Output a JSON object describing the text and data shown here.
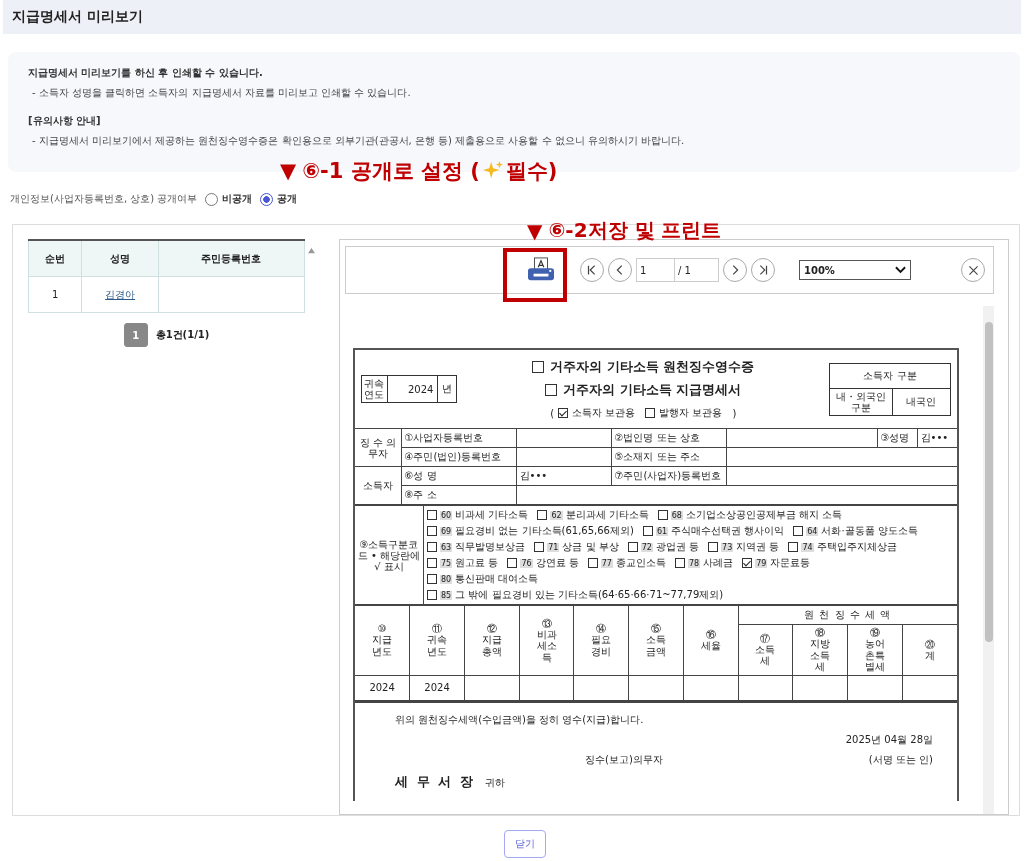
{
  "title": "지급명세서 미리보기",
  "notice": [
    {
      "heading": "지급명세서 미리보기를 하신 후 인쇄할 수 있습니다.",
      "detail": "- 소득자 성명을 클릭하면 소득자의 지급명세서 자료를 미리보고 인쇄할 수 있습니다."
    },
    {
      "heading": "[유의사항 안내]",
      "detail": "- 지급명세서 미리보기에서 제공하는 원천징수영수증은 확인용으로 외부기관(관공서, 은행 등) 제출용으로 사용할 수 없으니 유의하시기 바랍니다."
    }
  ],
  "annotation_1": {
    "arrow": "▼",
    "text": "⑥-1 공개로 설정 (",
    "tail": "필수)"
  },
  "annotation_2": {
    "arrow": "▼",
    "text": "⑥-2저장 및 프린트"
  },
  "disclosure": {
    "label": "개인정보(사업자등록번호, 상호) 공개여부",
    "options": [
      {
        "label": "비공개",
        "selected": false
      },
      {
        "label": "공개",
        "selected": true
      }
    ]
  },
  "earner_table": {
    "columns": [
      "순번",
      "성명",
      "주민등록번호"
    ],
    "rows": [
      {
        "no": "1",
        "name": "김경아"
      }
    ]
  },
  "pagination": {
    "pages": [
      {
        "label": "1",
        "selected": true
      }
    ],
    "total": "총1건(1/1)"
  },
  "viewer": {
    "page": "1",
    "page_total": "/ 1",
    "zoom": "100%"
  },
  "doc": {
    "year_label": "귀속연도",
    "year": "2024",
    "year_unit": "년",
    "titles": [
      {
        "text": "거주자의 기타소득 원천징수영수증",
        "checked": false
      },
      {
        "text": "거주자의 기타소득 지급명세서",
        "checked": false
      }
    ],
    "paren_open": "(",
    "paren_close": ")",
    "copies": [
      {
        "text": "소득자 보관용",
        "checked": true
      },
      {
        "text": "발행자 보관용",
        "checked": false
      }
    ],
    "class_title": "소득자 구분",
    "class_label": "내・외국인 구분",
    "class_value": "내국인",
    "payer": {
      "label": "징 수 의무자",
      "reg_no": "①사업자등록번호",
      "company": "②법인명 또는 상호",
      "name_label": "③성명",
      "name": "김•••",
      "id_no": "④주민(법인)등록번호",
      "address": "⑤소재지 또는 주소"
    },
    "earner": {
      "label": "소득자",
      "name_label": "⑥성 명",
      "name": "김•••",
      "id_no": "⑦주민(사업자)등록번호",
      "address": "⑧주 소"
    },
    "income_label": "⑨소득구분코드 • 해당란에 √ 표시",
    "income_types": [
      {
        "items": [
          {
            "code": "60",
            "text": "비과세 기타소득",
            "checked": false
          },
          {
            "code": "62",
            "text": "분리과세 기타소득",
            "checked": false
          },
          {
            "code": "68",
            "text": "소기업소상공인공제부금 해지 소득",
            "checked": false
          }
        ]
      },
      {
        "items": [
          {
            "code": "69",
            "text": "필요경비 없는 기타소득(61,65,66제외)",
            "checked": false
          },
          {
            "code": "61",
            "text": "주식매수선택권 행사이익",
            "checked": false
          },
          {
            "code": "64",
            "text": "서화·골동품 양도소득",
            "checked": false
          }
        ]
      },
      {
        "items": [
          {
            "code": "63",
            "text": "직무발명보상금",
            "checked": false
          },
          {
            "code": "71",
            "text": "상금 및 부상",
            "checked": false
          },
          {
            "code": "72",
            "text": "광업권 등",
            "checked": false
          },
          {
            "code": "73",
            "text": "지역권 등",
            "checked": false
          },
          {
            "code": "74",
            "text": "주택입주지체상금",
            "checked": false
          }
        ]
      },
      {
        "items": [
          {
            "code": "75",
            "text": "원고료 등",
            "checked": false
          },
          {
            "code": "76",
            "text": "강연료 등",
            "checked": false
          },
          {
            "code": "77",
            "text": "종교인소득",
            "checked": false
          },
          {
            "code": "78",
            "text": "사례금",
            "checked": false
          },
          {
            "code": "79",
            "text": "자문료등",
            "checked": true
          }
        ]
      },
      {
        "items": [
          {
            "code": "80",
            "text": "통신판매 대여소득",
            "checked": false
          }
        ]
      },
      {
        "items": [
          {
            "code": "85",
            "text": "그 밖에 필요경비 있는 기타소득(64·65·66·71~77,79제외)",
            "checked": false
          }
        ]
      }
    ],
    "amount_columns": [
      {
        "num": "⑩",
        "label": "지급년도"
      },
      {
        "num": "⑪",
        "label": "귀속년도"
      },
      {
        "num": "⑫",
        "label": "지급총액"
      },
      {
        "num": "⑬",
        "label": "비과세소득"
      },
      {
        "num": "⑭",
        "label": "필요경비"
      },
      {
        "num": "⑮",
        "label": "소득금액"
      },
      {
        "num": "⑯",
        "label": "세율"
      }
    ],
    "tax_group": "원 천 징 수 세 액",
    "tax_columns": [
      {
        "num": "⑰",
        "label": "소득세"
      },
      {
        "num": "⑱",
        "label": "지방소득세"
      },
      {
        "num": "⑲",
        "label": "농어촌특별세"
      },
      {
        "num": "⑳",
        "label": "계"
      }
    ],
    "amount_row": [
      "2024",
      "2024"
    ],
    "statement": "위의 원천징수세액(수입금액)을 정히 영수(지급)합니다.",
    "date": "2025년 04월 28일",
    "obligor": "징수(보고)의무자",
    "sign": "(서명 또는 인)",
    "office": "세 무 서 장",
    "honorific": "귀하"
  },
  "close_button": "닫기"
}
